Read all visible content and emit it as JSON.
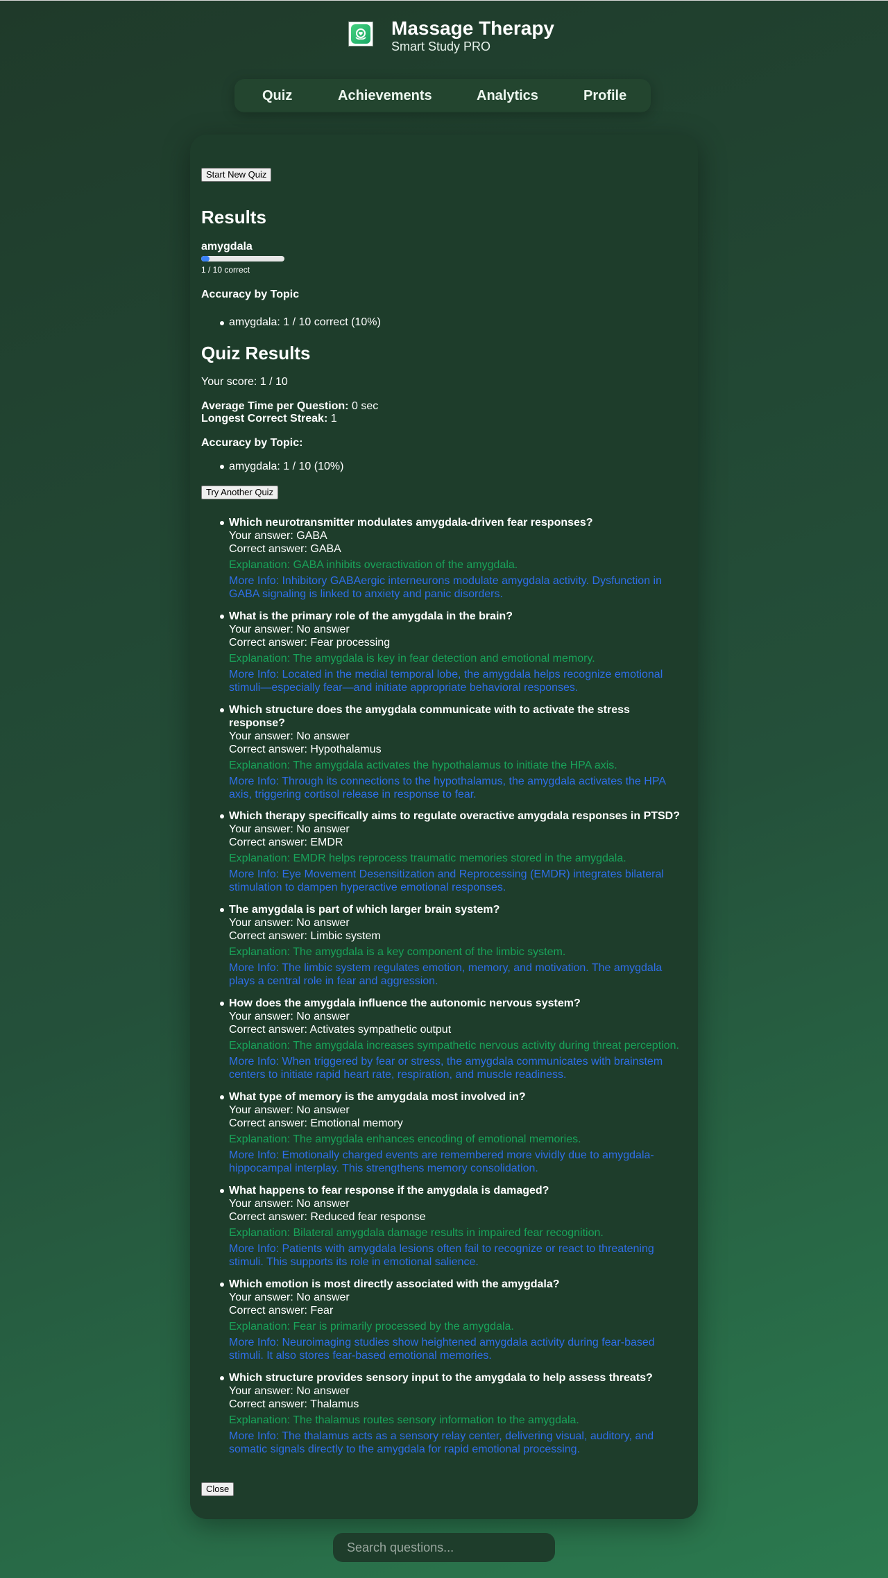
{
  "app": {
    "title": "Massage Therapy",
    "subtitle": "Smart Study PRO"
  },
  "nav": {
    "items": [
      "Quiz",
      "Achievements",
      "Analytics",
      "Profile"
    ]
  },
  "actions": {
    "start_new_quiz": "Start New Quiz",
    "try_another_quiz": "Try Another Quiz",
    "close": "Close"
  },
  "results": {
    "heading": "Results",
    "topic": {
      "name": "amygdala",
      "progress_fraction": 0.1,
      "caption": "1 / 10 correct"
    },
    "accuracy_heading": "Accuracy by Topic",
    "accuracy_items": [
      "amygdala: 1 / 10 correct (10%)"
    ]
  },
  "quiz_results": {
    "heading": "Quiz Results",
    "score_text": "Your score: 1 / 10",
    "avg_time_label": "Average Time per Question:",
    "avg_time_value": "0 sec",
    "streak_label": "Longest Correct Streak:",
    "streak_value": "1",
    "accuracy_heading": "Accuracy by Topic:",
    "accuracy_items": [
      "amygdala: 1 / 10 (10%)"
    ]
  },
  "review": [
    {
      "question": "Which neurotransmitter modulates amygdala-driven fear responses?",
      "your_answer": "Your answer: GABA",
      "correct_answer": "Correct answer: GABA",
      "explanation": "Explanation: GABA inhibits overactivation of the amygdala.",
      "more_info": "More Info: Inhibitory GABAergic interneurons modulate amygdala activity. Dysfunction in GABA signaling is linked to anxiety and panic disorders."
    },
    {
      "question": "What is the primary role of the amygdala in the brain?",
      "your_answer": "Your answer: No answer",
      "correct_answer": "Correct answer: Fear processing",
      "explanation": "Explanation: The amygdala is key in fear detection and emotional memory.",
      "more_info": "More Info: Located in the medial temporal lobe, the amygdala helps recognize emotional stimuli—especially fear—and initiate appropriate behavioral responses."
    },
    {
      "question": "Which structure does the amygdala communicate with to activate the stress response?",
      "your_answer": "Your answer: No answer",
      "correct_answer": "Correct answer: Hypothalamus",
      "explanation": "Explanation: The amygdala activates the hypothalamus to initiate the HPA axis.",
      "more_info": "More Info: Through its connections to the hypothalamus, the amygdala activates the HPA axis, triggering cortisol release in response to fear."
    },
    {
      "question": "Which therapy specifically aims to regulate overactive amygdala responses in PTSD?",
      "your_answer": "Your answer: No answer",
      "correct_answer": "Correct answer: EMDR",
      "explanation": "Explanation: EMDR helps reprocess traumatic memories stored in the amygdala.",
      "more_info": "More Info: Eye Movement Desensitization and Reprocessing (EMDR) integrates bilateral stimulation to dampen hyperactive emotional responses."
    },
    {
      "question": "The amygdala is part of which larger brain system?",
      "your_answer": "Your answer: No answer",
      "correct_answer": "Correct answer: Limbic system",
      "explanation": "Explanation: The amygdala is a key component of the limbic system.",
      "more_info": "More Info: The limbic system regulates emotion, memory, and motivation. The amygdala plays a central role in fear and aggression."
    },
    {
      "question": "How does the amygdala influence the autonomic nervous system?",
      "your_answer": "Your answer: No answer",
      "correct_answer": "Correct answer: Activates sympathetic output",
      "explanation": "Explanation: The amygdala increases sympathetic nervous activity during threat perception.",
      "more_info": "More Info: When triggered by fear or stress, the amygdala communicates with brainstem centers to initiate rapid heart rate, respiration, and muscle readiness."
    },
    {
      "question": "What type of memory is the amygdala most involved in?",
      "your_answer": "Your answer: No answer",
      "correct_answer": "Correct answer: Emotional memory",
      "explanation": "Explanation: The amygdala enhances encoding of emotional memories.",
      "more_info": "More Info: Emotionally charged events are remembered more vividly due to amygdala-hippocampal interplay. This strengthens memory consolidation."
    },
    {
      "question": "What happens to fear response if the amygdala is damaged?",
      "your_answer": "Your answer: No answer",
      "correct_answer": "Correct answer: Reduced fear response",
      "explanation": "Explanation: Bilateral amygdala damage results in impaired fear recognition.",
      "more_info": "More Info: Patients with amygdala lesions often fail to recognize or react to threatening stimuli. This supports its role in emotional salience."
    },
    {
      "question": "Which emotion is most directly associated with the amygdala?",
      "your_answer": "Your answer: No answer",
      "correct_answer": "Correct answer: Fear",
      "explanation": "Explanation: Fear is primarily processed by the amygdala.",
      "more_info": "More Info: Neuroimaging studies show heightened amygdala activity during fear-based stimuli. It also stores fear-based emotional memories."
    },
    {
      "question": "Which structure provides sensory input to the amygdala to help assess threats?",
      "your_answer": "Your answer: No answer",
      "correct_answer": "Correct answer: Thalamus",
      "explanation": "Explanation: The thalamus routes sensory information to the amygdala.",
      "more_info": "More Info: The thalamus acts as a sensory relay center, delivering visual, auditory, and somatic signals directly to the amygdala for rapid emotional processing."
    }
  ],
  "search": {
    "placeholder": "Search questions..."
  },
  "colors": {
    "explanation": "#19a35a",
    "more_info": "#2f6ee8",
    "progress_fill": "#3b82f6"
  },
  "icons": {
    "logo": "hands-heart-icon"
  }
}
